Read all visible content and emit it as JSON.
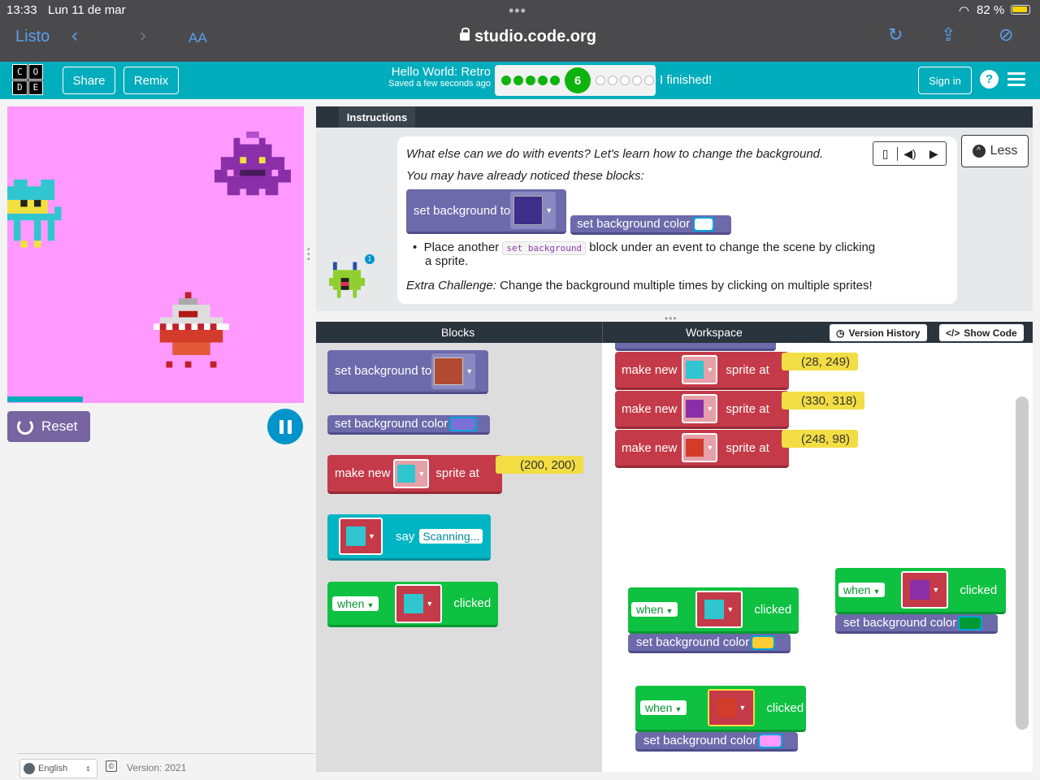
{
  "ios": {
    "time": "13:33",
    "date": "Lun 11 de mar",
    "battery": "82 %",
    "back_label": "Listo",
    "text_size": "AA",
    "url": "studio.code.org"
  },
  "header": {
    "logo_letters": [
      "C",
      "O",
      "D",
      "E"
    ],
    "share_label": "Share",
    "remix_label": "Remix",
    "project_title": "Hello World: Retro",
    "saved_status": "Saved a few seconds ago",
    "current_level": "6",
    "completed_levels": 5,
    "remaining_levels": 5,
    "finished_label": "I finished!",
    "sign_in_label": "Sign in",
    "help_label": "?"
  },
  "game": {
    "reset_label": "Reset",
    "background_color": "#ff99ff"
  },
  "footer": {
    "language": "English",
    "copyright_symbol": "©",
    "version": "Version: 2021"
  },
  "instructions": {
    "tab_label": "Instructions",
    "line1": "What else can we do with events? Let's learn how to change the background.",
    "line2": "You may have already noticed these blocks:",
    "example_block1": "set background to",
    "example_block2": "set background color",
    "bullet_before": "Place another",
    "bullet_code": "set background",
    "bullet_after": "block under an event to change the scene by clicking",
    "bullet_cont": "a sprite.",
    "extra_label": "Extra Challenge:",
    "extra_text": "Change the background multiple times by clicking on multiple sprites!",
    "less_label": "Less",
    "mascot_badge": "1"
  },
  "toolbox": {
    "title": "Blocks",
    "set_bg_to": "set background to",
    "set_bg_color": "set background color",
    "make_new": "make new",
    "sprite_at": "sprite at",
    "coord": "(200, 200)",
    "say": "say",
    "say_text": "Scanning...",
    "when": "when",
    "clicked": "clicked"
  },
  "workspace": {
    "title": "Workspace",
    "version_history": "Version History",
    "show_code": "Show Code",
    "make_new": "make new",
    "sprite_at": "sprite at",
    "coords": [
      "(28, 249)",
      "(330, 318)",
      "(248, 98)"
    ],
    "when": "when",
    "clicked": "clicked",
    "set_bg_color": "set background color",
    "bg_colors": [
      "#ffcc33",
      "#009933",
      "#ff99ff"
    ]
  }
}
